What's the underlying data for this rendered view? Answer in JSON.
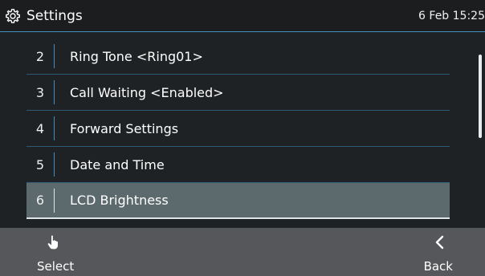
{
  "header": {
    "title": "Settings",
    "icon": "gear-icon",
    "datetime": "6 Feb 15:25"
  },
  "menu": {
    "items": [
      {
        "number": "2",
        "label": "Ring Tone <Ring01>"
      },
      {
        "number": "3",
        "label": "Call Waiting <Enabled>"
      },
      {
        "number": "4",
        "label": "Forward Settings"
      },
      {
        "number": "5",
        "label": "Date and Time"
      },
      {
        "number": "6",
        "label": "LCD Brightness"
      }
    ],
    "selected_number": "6"
  },
  "softkeys": {
    "left": {
      "label": "Select",
      "icon": "hand-pointer-icon"
    },
    "right": {
      "label": "Back",
      "icon": "chevron-left-icon"
    }
  },
  "colors": {
    "background": "#1f2224",
    "accent": "#3f8fbf",
    "selected_row": "#5c6a6e",
    "softkey_bar": "#55575a"
  }
}
